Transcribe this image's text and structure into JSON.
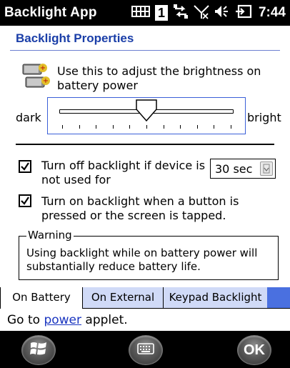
{
  "titlebar": {
    "app_title": "Backlight App",
    "clock": "7:44",
    "signal_number": "1",
    "icons": [
      "battery-grid-icon",
      "signal-one-icon",
      "sync-arrows-icon",
      "no-signal-icon",
      "speaker-icon",
      "power-plug-icon"
    ]
  },
  "header": {
    "title": "Backlight Properties"
  },
  "brightness": {
    "description": "Use this to adjust the brightness on battery power",
    "dark_label": "dark",
    "bright_label": "bright",
    "level_fraction": 0.5
  },
  "options": {
    "turn_off_label": "Turn off backlight if device is not used for",
    "turn_off_checked": true,
    "timeout_value": "30 sec",
    "turn_on_label": "Turn on backlight when a button is pressed or the screen is tapped.",
    "turn_on_checked": true
  },
  "warning": {
    "legend": "Warning",
    "text_line1": "Using backlight while on battery power will",
    "text_line2": "substantially reduce battery life."
  },
  "tabs": [
    {
      "label": "On Battery",
      "active": true
    },
    {
      "label": "On External",
      "active": false
    },
    {
      "label": "Keypad Backlight",
      "active": false
    }
  ],
  "footer": {
    "prefix": "Go to ",
    "link": "power",
    "suffix": " applet."
  },
  "softkeys": {
    "ok_label": "OK",
    "start_icon": "windows-start-icon",
    "keyboard_icon": "keyboard-icon"
  },
  "colors": {
    "header_title": "#1a3ea8",
    "tab_inactive": "#d0daf7",
    "tab_fill": "#4a70e0",
    "link": "#1a35c0"
  }
}
